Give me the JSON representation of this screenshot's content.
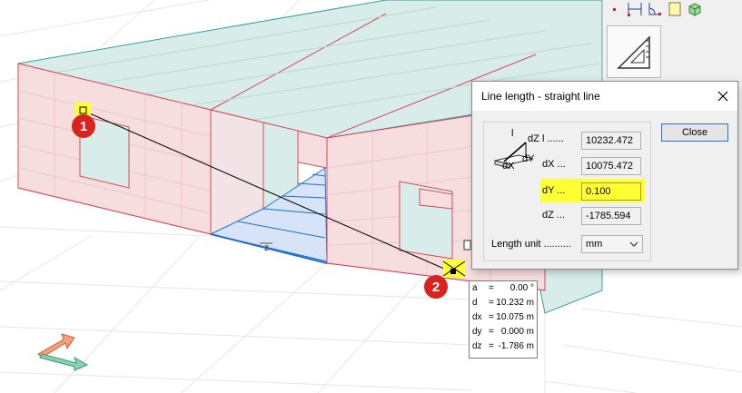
{
  "dialog": {
    "title": "Line length - straight line",
    "close_button": "Close",
    "fields": [
      {
        "label": "l ......",
        "value": "10232.472"
      },
      {
        "label": "dX ...",
        "value": "10075.472"
      },
      {
        "label": "dY ...",
        "value": "0.100"
      },
      {
        "label": "dZ ...",
        "value": "-1785.594"
      }
    ],
    "length_unit_label": "Length unit ..........",
    "length_unit_value": "mm",
    "icon_labels": {
      "l": "l",
      "dz": "dZ",
      "dx": "dX",
      "dy": "dY"
    }
  },
  "readout": [
    {
      "name": "a",
      "eq": "=",
      "value": "0.00 °"
    },
    {
      "name": "d",
      "eq": "=",
      "value": "10.232 m"
    },
    {
      "name": "dx",
      "eq": "=",
      "value": "10.075 m"
    },
    {
      "name": "dy",
      "eq": "=",
      "value": "0.000 m"
    },
    {
      "name": "dz",
      "eq": "=",
      "value": "-1.786 m"
    }
  ],
  "markers": {
    "start": "1",
    "end": "2"
  },
  "colors": {
    "wall_fill": "#f7dede",
    "wall_edge": "#d9475c",
    "roof_fill": "#d8ecea",
    "roof_edge": "#3aa0a0",
    "floor_fill": "#d7e4f7",
    "floor_edge": "#1f6fcf",
    "highlight": "#ffff33",
    "marker": "#d8231f"
  }
}
